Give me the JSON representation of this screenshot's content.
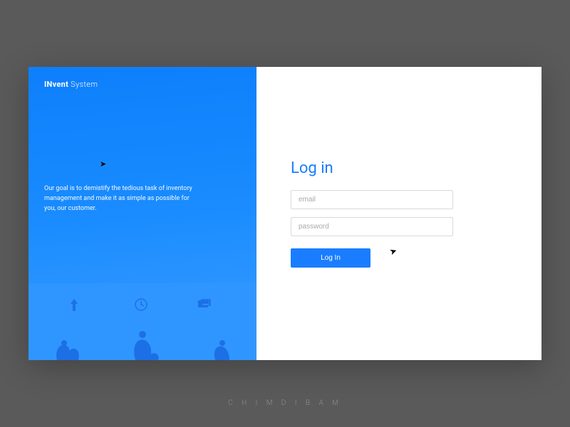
{
  "brand": {
    "bold": "INvent",
    "light": "System"
  },
  "tagline": "Our goal is to demistify the tedious task of inventory management and make it as simple as possible for you, our customer.",
  "form": {
    "title": "Log in",
    "email_placeholder": "email",
    "password_placeholder": "password",
    "submit_label": "Log In"
  },
  "credit": "C H I M D I   B A M",
  "colors": {
    "accent": "#1a7dff",
    "panel_gradient_from": "#0d7ffb",
    "panel_gradient_to": "#3a9cff",
    "illustration_bg": "#2f96ff",
    "illustration_fg": "#1d6fe6"
  }
}
